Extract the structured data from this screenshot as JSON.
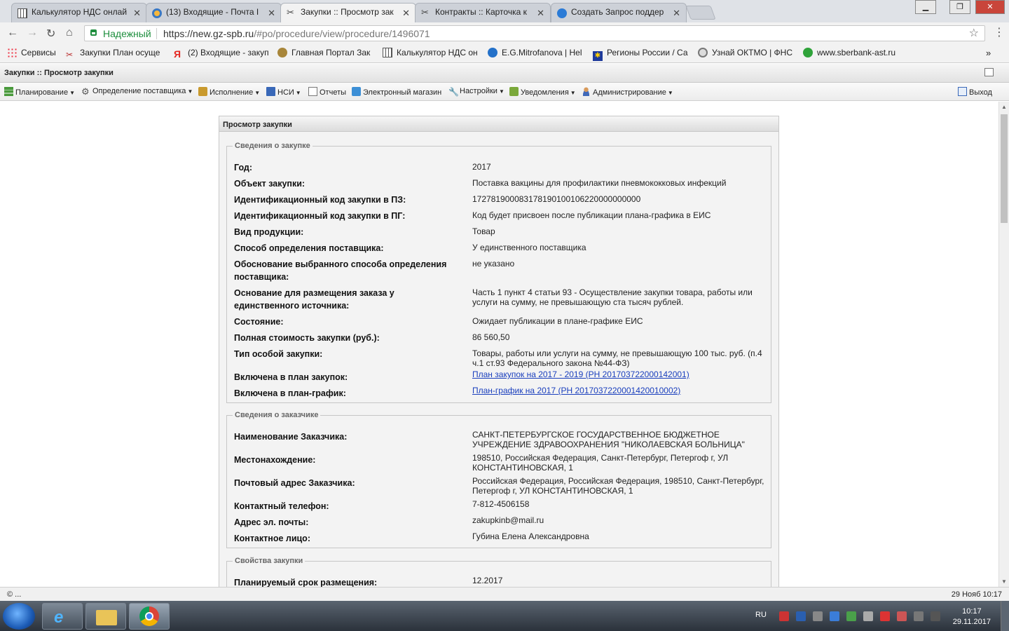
{
  "browser": {
    "tabs": [
      {
        "title": "Калькулятор НДС онлай",
        "icon": "calculator-icon",
        "active": false
      },
      {
        "title": "(13) Входящие - Почта I",
        "icon": "mail-icon",
        "active": false
      },
      {
        "title": "Закупки :: Просмотр зак",
        "icon": "tools-icon",
        "active": true
      },
      {
        "title": "Контракты :: Карточка к",
        "icon": "tools-icon",
        "active": false
      },
      {
        "title": "Создать Запрос поддер",
        "icon": "help-icon",
        "active": false
      }
    ],
    "secure_label": "Надежный",
    "url_host": "https://new.gz-spb.ru",
    "url_path": "/#po/procedure/view/procedure/1496071",
    "bookmarks": [
      {
        "label": "Сервисы",
        "icon": "apps-grid-icon"
      },
      {
        "label": "Закупки План осуще",
        "icon": "tools-icon"
      },
      {
        "label": "(2) Входящие - закуп",
        "icon": "yandex-icon"
      },
      {
        "label": "Главная Портал Зак",
        "icon": "eagle-emblem-icon"
      },
      {
        "label": "Калькулятор НДС он",
        "icon": "calculator-icon"
      },
      {
        "label": "E.G.Mitrofanova | Hel",
        "icon": "globe-icon"
      },
      {
        "label": "Регионы России / Са",
        "icon": "star-flag-icon"
      },
      {
        "label": "Узнай ОКТМО | ФНС",
        "icon": "fns-emblem-icon"
      },
      {
        "label": "www.sberbank-ast.ru",
        "icon": "sberbank-icon"
      }
    ],
    "bookmarks_more": "»"
  },
  "app": {
    "header_title": "Закупки :: Просмотр закупки",
    "menu": [
      {
        "label": "Планирование",
        "icon": "planning-icon",
        "dropdown": true
      },
      {
        "label": "Определение поставщика",
        "icon": "gear-icon",
        "dropdown": true
      },
      {
        "label": "Исполнение",
        "icon": "execution-icon",
        "dropdown": true
      },
      {
        "label": "НСИ",
        "icon": "book-icon",
        "dropdown": true
      },
      {
        "label": "Отчеты",
        "icon": "report-icon",
        "dropdown": false
      },
      {
        "label": "Электронный магазин",
        "icon": "cart-icon",
        "dropdown": false
      },
      {
        "label": "Настройки",
        "icon": "wrench-icon",
        "dropdown": true
      },
      {
        "label": "Уведомления",
        "icon": "notification-icon",
        "dropdown": true
      },
      {
        "label": "Администрирование",
        "icon": "user-icon",
        "dropdown": true
      }
    ],
    "logout_label": "Выход"
  },
  "panel": {
    "title": "Просмотр закупки",
    "sections": [
      {
        "legend": "Сведения о закупке",
        "rows": [
          {
            "k": "Год:",
            "v": "2017"
          },
          {
            "k": "Объект закупки:",
            "v": "Поставка вакцины для профилактики пневмококковых инфекций"
          },
          {
            "k": "Идентификационный код закупки в ПЗ:",
            "v": "172781900083178190100106220000000000"
          },
          {
            "k": "Идентификационный код закупки в ПГ:",
            "v": "Код будет присвоен после публикации плана-графика в ЕИС"
          },
          {
            "k": "Вид продукции:",
            "v": "Товар"
          },
          {
            "k": "Способ определения поставщика:",
            "v": "У единственного поставщика"
          },
          {
            "k": "Обоснование выбранного способа определения поставщика:",
            "v": "не указано"
          },
          {
            "k": "Основание для размещения заказа у единственного источника:",
            "v": "Часть 1 пункт 4 статьи 93 - Осуществление закупки товара, работы или услуги на сумму, не превышающую ста тысяч рублей."
          },
          {
            "k": "Состояние:",
            "v": "Ожидает публикации в плане-графике ЕИС"
          },
          {
            "k": "Полная стоимость закупки (руб.):",
            "v": "86 560,50"
          },
          {
            "k": "Тип особой закупки:",
            "v": "Товары, работы или услуги на сумму, не превышающую 100 тыс. руб. (п.4 ч.1 ст.93 Федерального закона №44-ФЗ)"
          },
          {
            "k": "Включена в план закупок:",
            "v": "План закупок на 2017 - 2019 (РН 201703722000142001)",
            "link": true
          },
          {
            "k": "Включена в план-график:",
            "v": "План-график на 2017 (РН 2017037220001420010002)",
            "link": true
          }
        ]
      },
      {
        "legend": "Сведения о заказчике",
        "rows": [
          {
            "k": "Наименование Заказчика:",
            "v": "САНКТ-ПЕТЕРБУРГСКОЕ ГОСУДАРСТВЕННОЕ БЮДЖЕТНОЕ УЧРЕЖДЕНИЕ ЗДРАВООХРАНЕНИЯ \"НИКОЛАЕВСКАЯ БОЛЬНИЦА\""
          },
          {
            "k": "Местонахождение:",
            "v": "198510, Российская Федерация, Санкт-Петербург, Петергоф г, УЛ КОНСТАНТИНОВСКАЯ, 1"
          },
          {
            "k": "Почтовый адрес Заказчика:",
            "v": "Российская Федерация, Российская Федерация, 198510, Санкт-Петербург, Петергоф г, УЛ КОНСТАНТИНОВСКАЯ, 1"
          },
          {
            "k": "Контактный телефон:",
            "v": "7-812-4506158"
          },
          {
            "k": "Адрес эл. почты:",
            "v": "zakupkinb@mail.ru"
          },
          {
            "k": "Контактное лицо:",
            "v": "Губина Елена Александровна"
          }
        ]
      },
      {
        "legend": "Свойства закупки",
        "rows": [
          {
            "k": "Планируемый срок размещения:",
            "v": "12.2017"
          }
        ]
      }
    ]
  },
  "statusbar": {
    "left": "© ...",
    "right": "29 Нояб 10:17"
  },
  "taskbar": {
    "lang": "RU",
    "time": "10:17",
    "date": "29.11.2017"
  }
}
